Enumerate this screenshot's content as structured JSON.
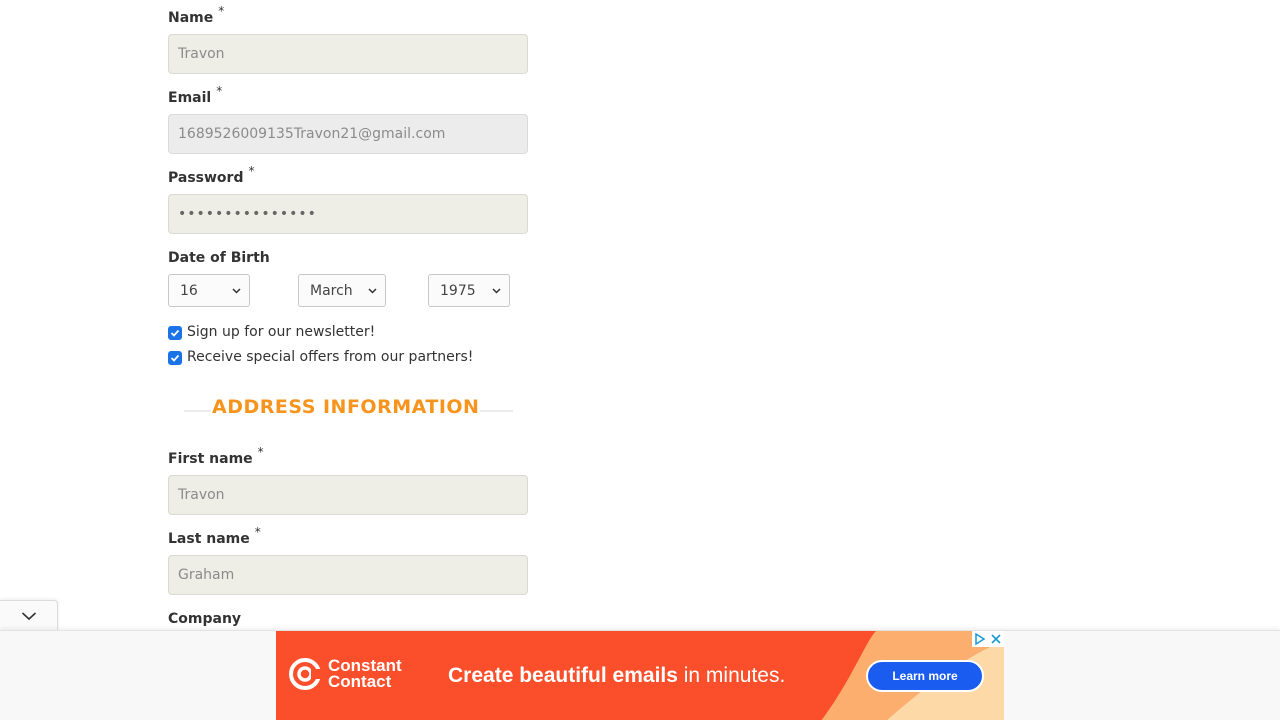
{
  "form": {
    "name": {
      "label": "Name",
      "required_mark": "*",
      "value": "Travon"
    },
    "email": {
      "label": "Email",
      "required_mark": "*",
      "value": "1689526009135Travon21@gmail.com"
    },
    "password": {
      "label": "Password",
      "required_mark": "*",
      "value": "•••••••••••••••"
    },
    "dob": {
      "label": "Date of Birth",
      "day": "16",
      "month": "March",
      "year": "1975"
    },
    "newsletter": {
      "label": "Sign up for our newsletter!",
      "checked": true
    },
    "offers": {
      "label": "Receive special offers from our partners!",
      "checked": true
    }
  },
  "address": {
    "section_title": "ADDRESS INFORMATION",
    "first_name": {
      "label": "First name",
      "required_mark": "*",
      "value": "Travon"
    },
    "last_name": {
      "label": "Last name",
      "required_mark": "*",
      "value": "Graham"
    },
    "company": {
      "label": "Company"
    }
  },
  "ad": {
    "brand_line1": "Constant",
    "brand_line2": "Contact",
    "headline_bold": "Create beautiful emails",
    "headline_rest": " in minutes.",
    "cta": "Learn more",
    "colors": {
      "background": "#fb4f2b",
      "cta": "#1a5cf0",
      "wave": "#fcae6e"
    }
  },
  "icons": {
    "collapse": "chevron-down-icon",
    "adchoices": "adchoices-icon",
    "close": "close-icon"
  }
}
